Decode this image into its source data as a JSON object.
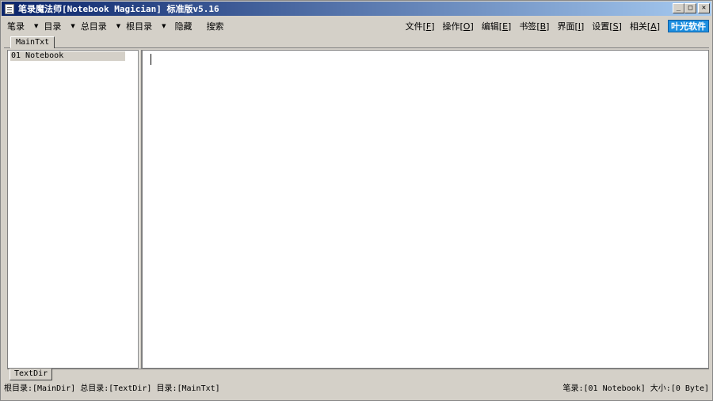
{
  "window": {
    "title": "笔录魔法师[Notebook Magician] 标准版v5.16",
    "minimize_glyph": "_",
    "maximize_glyph": "□",
    "close_glyph": "✕"
  },
  "toolbar": {
    "left": [
      {
        "label": "笔录",
        "dropdown": true
      },
      {
        "label": "目录",
        "dropdown": true
      },
      {
        "label": "总目录",
        "dropdown": true
      },
      {
        "label": "根目录",
        "dropdown": true
      },
      {
        "label": "隐藏",
        "dropdown": false
      },
      {
        "label": "搜索",
        "dropdown": false
      }
    ],
    "right": [
      {
        "label": "文件",
        "key": "F"
      },
      {
        "label": "操作",
        "key": "O"
      },
      {
        "label": "编辑",
        "key": "E"
      },
      {
        "label": "书签",
        "key": "B"
      },
      {
        "label": "界面",
        "key": "I"
      },
      {
        "label": "设置",
        "key": "S"
      },
      {
        "label": "相关",
        "key": "A"
      }
    ],
    "brand": "叶光软件"
  },
  "tabs": {
    "top": "MainTxt",
    "bottom": "TextDir"
  },
  "tree": {
    "items": [
      "01 Notebook"
    ]
  },
  "status": {
    "left": "根目录:[MainDir] 总目录:[TextDir] 目录:[MainTxt]",
    "right": "笔录:[01 Notebook] 大小:[0 Byte]"
  },
  "colors": {
    "title_gradient_start": "#0a246a",
    "title_gradient_end": "#a6caf0",
    "chrome": "#d4d0c8",
    "brand_bg": "#1d8fe0"
  }
}
